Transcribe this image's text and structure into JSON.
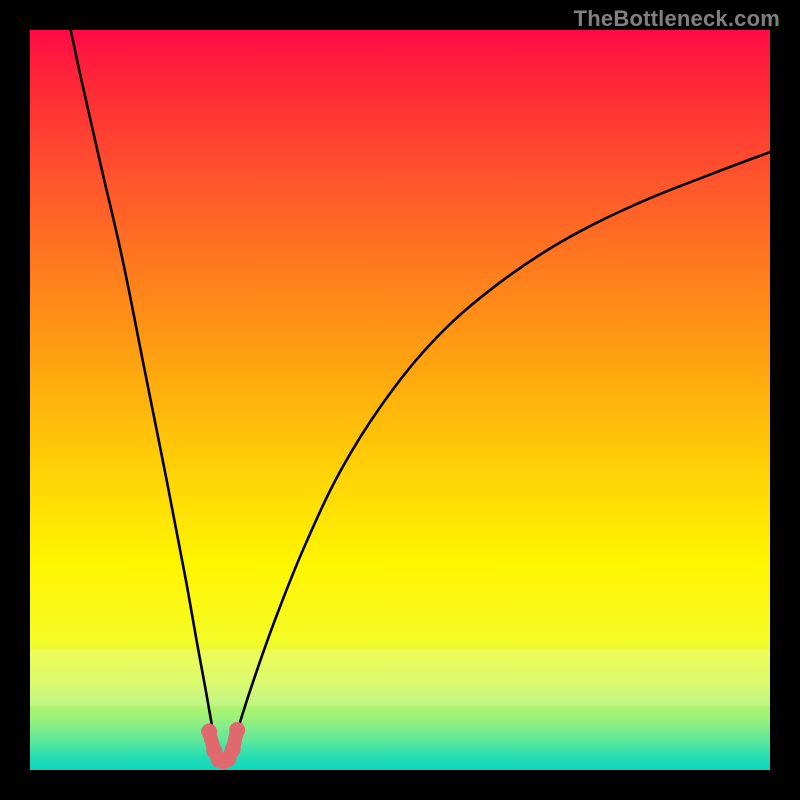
{
  "watermark": {
    "text": "TheBottleneck.com"
  },
  "colors": {
    "background": "#000000",
    "gradient_top": "#ff0a47",
    "gradient_bottom": "#0cd7c0",
    "curve_left": "#000000",
    "curve_right": "#000000",
    "marker_fill": "#e0696e",
    "marker_stroke": "#c84a50"
  },
  "chart_data": {
    "type": "line",
    "title": "",
    "xlabel": "",
    "ylabel": "",
    "xlim": [
      0,
      100
    ],
    "ylim": [
      0,
      100
    ],
    "grid": false,
    "legend": false,
    "description": "Two monotone curves descending from top toward a common minimum near the bottom-left-quarter, forming a narrow V; a short pink marker segment highlights the bottom of the V.",
    "annotations": [
      "TheBottleneck.com"
    ],
    "left_curve_comment": "steep descent from upper-left to valley floor",
    "right_curve_comment": "rises from valley floor toward upper-right, flattening",
    "series": [
      {
        "name": "left-curve",
        "x": [
          5.5,
          7.0,
          9.5,
          12.5,
          15.5,
          18.5,
          21.0,
          22.6,
          23.8,
          24.6,
          25.3,
          25.7
        ],
        "y": [
          100,
          93,
          82,
          69,
          54,
          39,
          26,
          17,
          10.5,
          6.0,
          3.0,
          1.8
        ]
      },
      {
        "name": "right-curve",
        "x": [
          26.6,
          27.3,
          28.3,
          30.0,
          33.0,
          37.0,
          42.0,
          48.0,
          55.0,
          63.0,
          72.0,
          82.0,
          92.0,
          100.0
        ],
        "y": [
          1.8,
          3.0,
          6.2,
          11.5,
          20.0,
          30.0,
          40.5,
          50.0,
          58.5,
          65.5,
          71.5,
          76.5,
          80.5,
          83.5
        ]
      },
      {
        "name": "valley-marker",
        "x": [
          24.2,
          24.9,
          25.5,
          26.1,
          26.8,
          27.4,
          28.0
        ],
        "y": [
          5.2,
          2.6,
          1.4,
          1.2,
          1.5,
          2.8,
          5.4
        ]
      }
    ],
    "valley": {
      "x": 26.1,
      "y": 1.2
    }
  }
}
